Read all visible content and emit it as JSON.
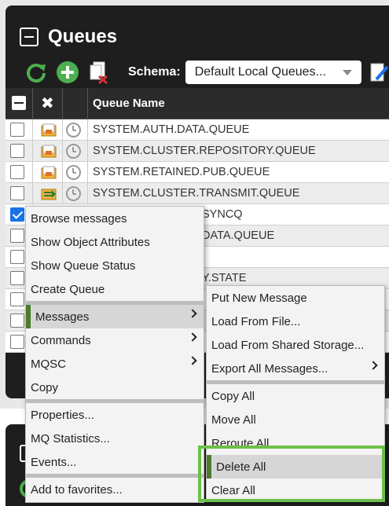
{
  "panel": {
    "title": "Queues"
  },
  "toolbar": {
    "schema_label": "Schema:",
    "schema_value": "Default Local Queues..."
  },
  "table": {
    "header_x": "✖",
    "header_name": "Queue Name",
    "rows": [
      {
        "name": "SYSTEM.AUTH.DATA.QUEUE"
      },
      {
        "name": "SYSTEM.CLUSTER.REPOSITORY.QUEUE"
      },
      {
        "name": "SYSTEM.RETAINED.PUB.QUEUE"
      },
      {
        "name": "SYSTEM.CLUSTER.TRANSMIT.QUEUE"
      },
      {
        "name": "SYNCQ"
      },
      {
        "name": "DATA.QUEUE"
      },
      {
        "name": ""
      },
      {
        "name": "Y.STATE"
      },
      {
        "name": ""
      },
      {
        "name": ""
      },
      {
        "name": ""
      }
    ]
  },
  "context_menu": {
    "items": {
      "browse": "Browse messages",
      "show_attrs": "Show Object Attributes",
      "show_status": "Show Queue Status",
      "create": "Create Queue",
      "messages": "Messages",
      "commands": "Commands",
      "mqsc": "MQSC",
      "copy": "Copy",
      "properties": "Properties...",
      "mq_stats": "MQ Statistics...",
      "events": "Events...",
      "favorites": "Add to favorites..."
    }
  },
  "submenu": {
    "items": {
      "put_new": "Put New Message",
      "load_file": "Load From File...",
      "load_shared": "Load From Shared Storage...",
      "export_all": "Export All Messages...",
      "copy_all": "Copy All",
      "move_all": "Move All",
      "reroute_all": "Reroute All",
      "delete_all": "Delete All",
      "clear_all": "Clear All"
    }
  },
  "colors": {
    "accent_green": "#6cc04a",
    "highlight_bar": "#4d7a2b",
    "check_blue": "#1a73e8"
  }
}
